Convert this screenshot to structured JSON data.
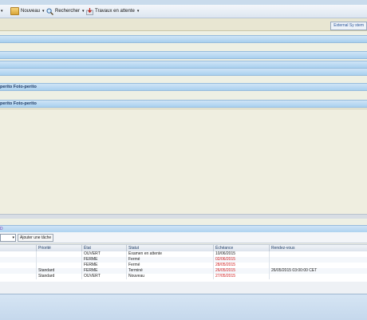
{
  "toolbar": {
    "items": [
      {
        "label": "Nouveau",
        "icon": "new-folder-icon"
      },
      {
        "label": "Rechercher",
        "icon": "search-icon"
      },
      {
        "label": "Travaux en attente",
        "icon": "pending-jobs-icon"
      }
    ]
  },
  "external_button": "External Sy stem",
  "sections": [
    {
      "label": ""
    },
    {
      "label": ""
    },
    {
      "label": ""
    },
    {
      "label": ""
    },
    {
      "label": "perito Foto-perito"
    },
    {
      "label": "perito Foto-perito"
    }
  ],
  "tasks": {
    "header_label": "D",
    "add_task_label": "Ajouter une tâche",
    "columns": [
      "Priorité",
      "État",
      "Statut",
      "Échéance",
      "Rendez-vous"
    ],
    "rows": [
      {
        "priority": "",
        "state": "OUVERT",
        "status": "Examen en attente",
        "due": "10/06/2015",
        "due_overdue": false,
        "appointment": ""
      },
      {
        "priority": "",
        "state": "FERMÉ",
        "status": "Fermé",
        "due": "02/06/2015",
        "due_overdue": true,
        "appointment": ""
      },
      {
        "priority": "",
        "state": "FERMÉ",
        "status": "Fermé",
        "due": "28/05/2015",
        "due_overdue": true,
        "appointment": ""
      },
      {
        "priority": "Standard",
        "state": "FERMÉ",
        "status": "Terminé",
        "due": "26/05/2015",
        "due_overdue": true,
        "appointment": "26/05/2015 03:00:00 CET"
      },
      {
        "priority": "Standard",
        "state": "OUVERT",
        "status": "Nouveau",
        "due": "27/05/2015",
        "due_overdue": true,
        "appointment": ""
      }
    ]
  },
  "colors": {
    "accent": "#a9d0ef",
    "overdue": "#d11a1a"
  }
}
